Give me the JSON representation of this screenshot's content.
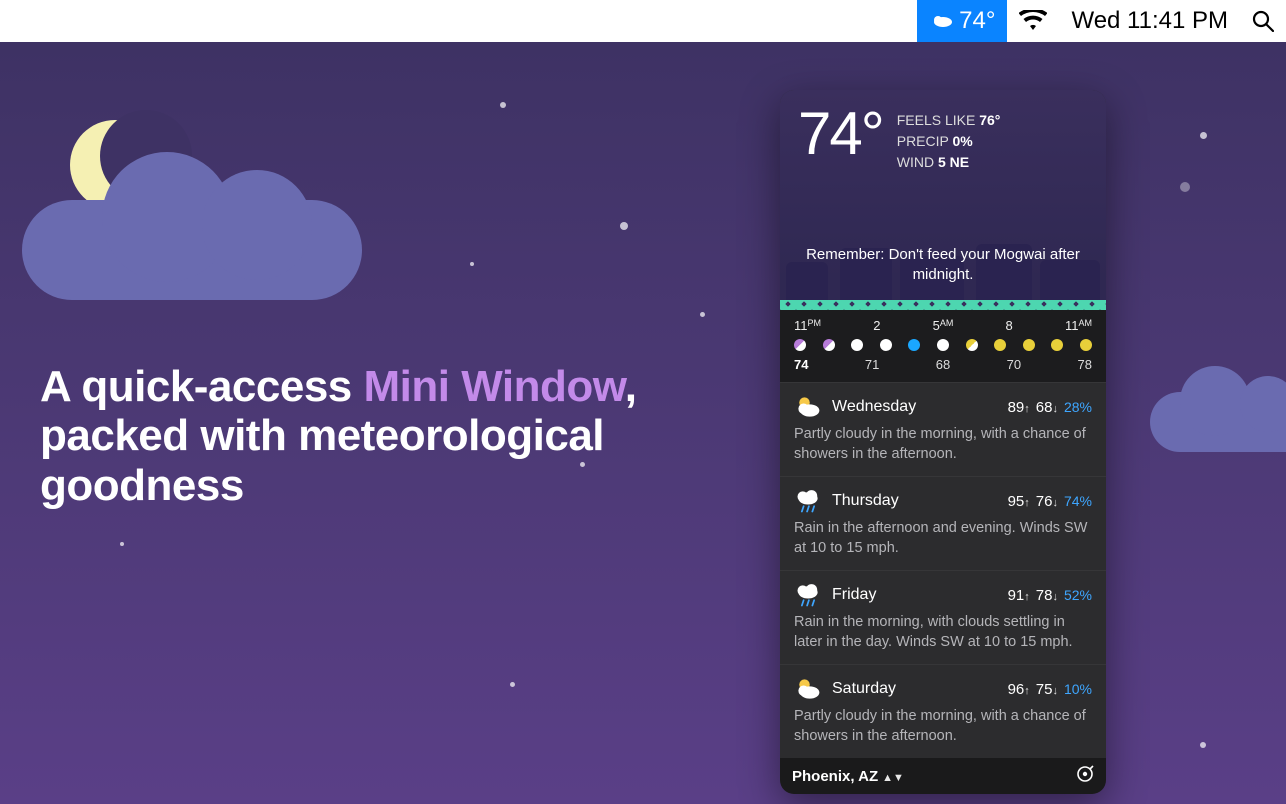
{
  "menubar": {
    "temp": "74°",
    "clock": "Wed 11:41 PM"
  },
  "headline": {
    "pre": "A quick-access ",
    "accent": "Mini Window",
    "post": ", packed with meteorological goodness"
  },
  "current": {
    "temp": "74°",
    "feels_label": "FEELS LIKE",
    "feels_value": "76°",
    "precip_label": "PRECIP",
    "precip_value": "0%",
    "wind_label": "WIND",
    "wind_value": "5 NE",
    "tip": "Remember: Don't feed your Mogwai after midnight."
  },
  "hourly": {
    "labels": [
      "11PM",
      "",
      "2",
      "",
      "5AM",
      "",
      "8",
      "",
      "11AM"
    ],
    "dot_colors": [
      "#b77bd9",
      "#b77bd9",
      "#ffffff",
      "#ffffff",
      "#1aa7ff",
      "#ffffff",
      "#e8cf3a",
      "#e8cf3a",
      "#e8cf3a"
    ],
    "dot_colors_extra": [
      "#e8cf3a",
      "#e8cf3a"
    ],
    "temps": [
      "74",
      "",
      "71",
      "",
      "68",
      "",
      "70",
      "",
      "78"
    ]
  },
  "days": [
    {
      "name": "Wednesday",
      "icon": "partly",
      "hi": "89",
      "lo": "68",
      "pct": "28%",
      "desc": "Partly cloudy in the morning, with a chance of showers in the afternoon."
    },
    {
      "name": "Thursday",
      "icon": "rain",
      "hi": "95",
      "lo": "76",
      "pct": "74%",
      "desc": "Rain in the afternoon and evening. Winds SW at 10 to 15 mph."
    },
    {
      "name": "Friday",
      "icon": "rain",
      "hi": "91",
      "lo": "78",
      "pct": "52%",
      "desc": "Rain in the morning, with clouds settling in later in the day. Winds SW at 10 to 15 mph."
    },
    {
      "name": "Saturday",
      "icon": "partly",
      "hi": "96",
      "lo": "75",
      "pct": "10%",
      "desc": "Partly cloudy in the morning, with a chance of showers in the afternoon."
    }
  ],
  "footer": {
    "location": "Phoenix, AZ"
  }
}
